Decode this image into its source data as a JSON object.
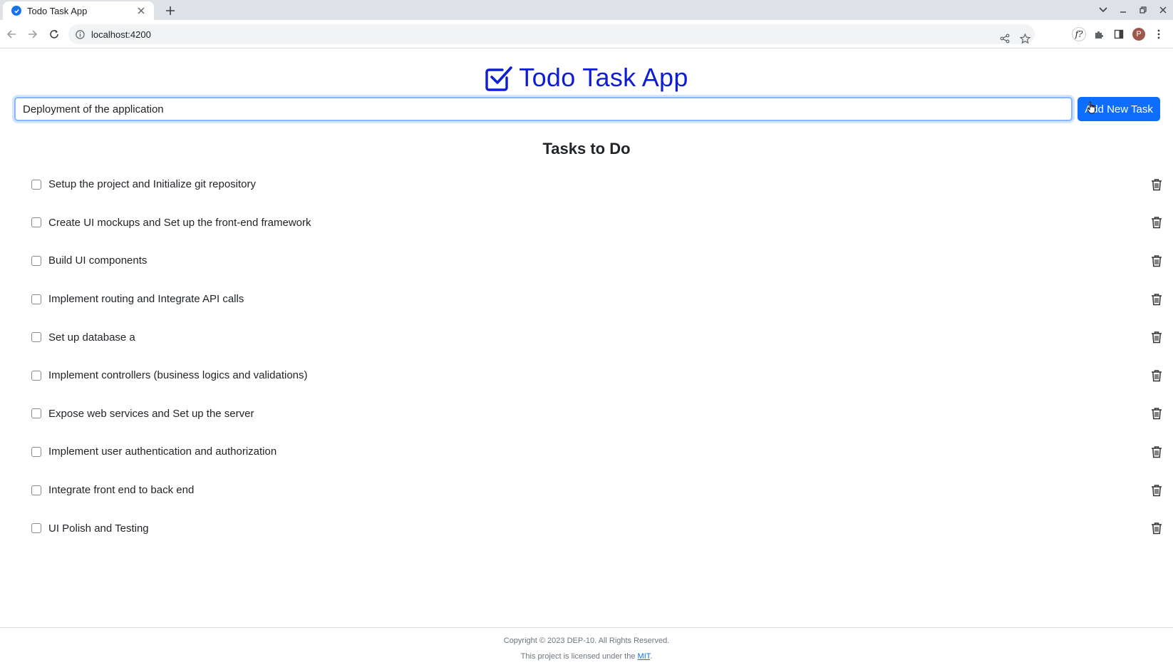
{
  "browser": {
    "tab_title": "Todo Task App",
    "url": "localhost:4200",
    "avatar_letter": "P",
    "extension_label": "f?"
  },
  "app": {
    "title": "Todo Task App",
    "accent_color": "#0d1dd6",
    "input_value": "Deployment of the application",
    "add_button_label": "Add New Task",
    "tasks_heading": "Tasks to Do",
    "tasks": [
      {
        "text": "Setup the project and Initialize git repository",
        "done": false
      },
      {
        "text": "Create UI mockups and Set up the front-end framework",
        "done": false
      },
      {
        "text": "Build UI components",
        "done": false
      },
      {
        "text": "Implement routing and Integrate API calls",
        "done": false
      },
      {
        "text": "Set up database a",
        "done": false
      },
      {
        "text": "Implement controllers (business logics and validations)",
        "done": false
      },
      {
        "text": "Expose web services and Set up the server",
        "done": false
      },
      {
        "text": "Implement user authentication and authorization",
        "done": false
      },
      {
        "text": "Integrate front end to back end",
        "done": false
      },
      {
        "text": "UI Polish and Testing",
        "done": false
      }
    ]
  },
  "footer": {
    "copyright": "Copyright © 2023 DEP-10. All Rights Reserved.",
    "license_prefix": "This project is licensed under the",
    "license_link": "MIT",
    "license_suffix": "."
  }
}
